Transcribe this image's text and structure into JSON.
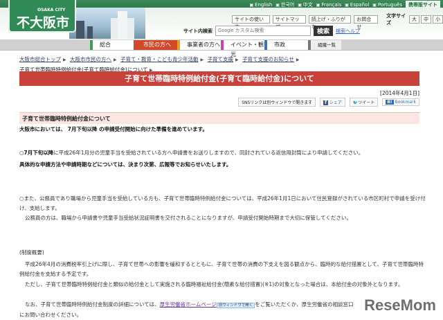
{
  "languages": [
    "English",
    "한국어",
    "中文",
    "Français",
    "Español",
    "Português"
  ],
  "mobile_link": "携帯版サイト",
  "logo": {
    "sub": "OSAKA CITY",
    "main": "大阪市"
  },
  "header_links": [
    "サイトの使い方",
    "サイトマップ",
    "読上げ・ふりがな",
    "お問合せ"
  ],
  "font_size": {
    "label": "文字サイズ",
    "options": [
      "大",
      "中",
      "小"
    ]
  },
  "search": {
    "label": "サイト内検索",
    "placeholder": "Google カスタム検索",
    "button": "検索",
    "help": "検索ヘルプ"
  },
  "nav": [
    {
      "label": "総合",
      "color": "#3aa050"
    },
    {
      "label": "市民の方へ",
      "color": "#d04a2a",
      "active": true
    },
    {
      "label": "事業者の方へ",
      "color": "#e8a020"
    },
    {
      "label": "イベント・観光",
      "color": "#d040b0"
    },
    {
      "label": "市政",
      "color": "#3a70c0"
    },
    {
      "label": "組織一覧",
      "color": "#777"
    }
  ],
  "breadcrumb": [
    "大阪市総合トップ",
    "大阪市市民の方へ",
    "子育て・教育・こども青少年活動",
    "子育て支援",
    "子育て支援のお知らせ"
  ],
  "breadcrumb_current": "子育て世帯臨時特例給付金(子育て臨時給付金)について",
  "title": "子育て世帯臨時特例給付金(子育て臨時給付金)について",
  "date": "[2014年4月1日]",
  "sns": {
    "note": "SNSリンクは別ウィンドウで開きます",
    "share": "シェア",
    "tweet": "ツイート",
    "bookmark": "Bookmark"
  },
  "section_heading": "子育て世帯臨時特例給付金について",
  "p1": "大阪市においては、 7月下旬以降 の申請受付開始に向けた準備を進めています。",
  "p2_bold": "○7月下旬以降",
  "p2": "に平成26年1月分の児童手当を受給されている方へ申請書をお送りしますので、同封されている返信用封筒により申請してください。",
  "p3": "具体的な申請方法や申請時期などについては、決まり次第、広報等でお知らせいたします。",
  "p4": "○また、公務員であり職場から児童手当を受給している方も、子育て世帯臨時特例給付金については、平成26年1月1日において住民登録がされている市区町村で申請を受け付け、支給します。",
  "p5": "公務員の方は、職場から申請書や児童手当受給状況証明書を交付されることになりますが、申請受付開始時期まで大切に保管してください。",
  "p6": "(制度概要)",
  "p7": "平成26年4月の消費税率引上げに際し、子育て世帯への影響を緩和するとともに、子育て世帯の消費の下支えを図る観点から、臨時的な給付措置として、子育て世帯臨時特例給付金を支給する予定です。",
  "p8": "ただし、子育て世帯臨時特例給付金と類似の給付金として実施される臨時福祉給付金(簡素な給付措置)(※1)の対象となった場合は、本給付金の対象外となります。",
  "p9_pre": "なお、子育て世帯臨時特例給付金制度の詳細については、",
  "p9_link": "厚生労働省ホームページ",
  "p9_new": "別ウィンドウで開く",
  "p9_post": "をご覧いただくか、厚生労働省の相談窓口",
  "p9_end": "にお問い合わせください。",
  "watermark": "ReseMom"
}
